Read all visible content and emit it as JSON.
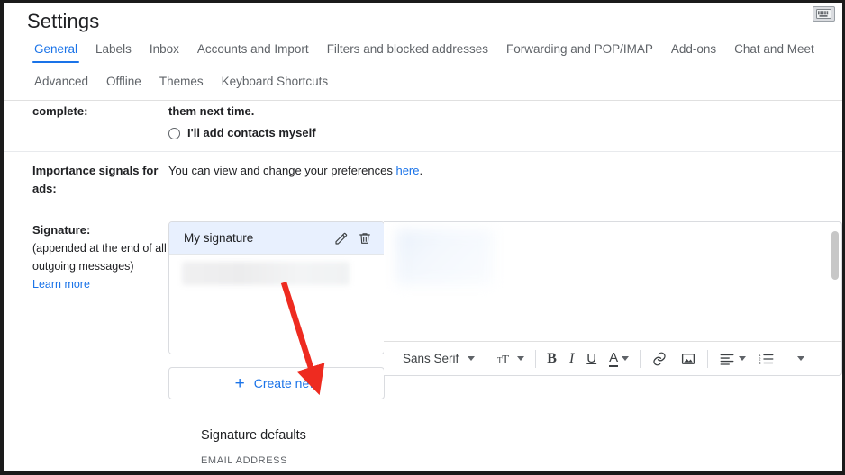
{
  "window": {
    "title": "Settings",
    "keyboard_icon": "keyboard-icon"
  },
  "tabs": {
    "row1": [
      {
        "label": "General",
        "active": true
      },
      {
        "label": "Labels",
        "active": false
      },
      {
        "label": "Inbox",
        "active": false
      },
      {
        "label": "Accounts and Import",
        "active": false
      },
      {
        "label": "Filters and blocked addresses",
        "active": false
      },
      {
        "label": "Forwarding and POP/IMAP",
        "active": false
      },
      {
        "label": "Add-ons",
        "active": false
      },
      {
        "label": "Chat and Meet",
        "active": false
      }
    ],
    "row2": [
      {
        "label": "Advanced",
        "active": false
      },
      {
        "label": "Offline",
        "active": false
      },
      {
        "label": "Themes",
        "active": false
      },
      {
        "label": "Keyboard Shortcuts",
        "active": false
      }
    ]
  },
  "rows": {
    "autocomplete": {
      "label": "complete:",
      "text_line1": "them next time.",
      "radio_label": "I'll add contacts myself"
    },
    "importance": {
      "label_line1": "Importance signals for",
      "label_line2": "ads:",
      "text_before": "You can view and change your preferences ",
      "link": "here",
      "text_after": "."
    },
    "signature": {
      "label": "Signature:",
      "sub_line1": "(appended at the end of all",
      "sub_line2": "outgoing messages)",
      "learn_more": "Learn more",
      "list": [
        {
          "name": "My signature",
          "selected": true,
          "edit_icon": "pencil-icon",
          "delete_icon": "trash-icon"
        }
      ],
      "create_button": {
        "plus": "+",
        "label": "Create new"
      },
      "editor": {
        "toolbar": {
          "font_family": "Sans Serif",
          "font_size_icon": "text-size-icon",
          "bold": "B",
          "italic": "I",
          "underline": "U",
          "text_color": "A",
          "link_icon": "link-icon",
          "image_icon": "image-icon",
          "align_icon": "align-left-icon",
          "numbered_list_icon": "numbered-list-icon",
          "more_icon": "more-options-icon"
        }
      }
    }
  },
  "defaults_section": {
    "heading": "Signature defaults",
    "column_header": "EMAIL ADDRESS"
  },
  "annotation": {
    "arrow_color": "#ee2b20",
    "points_to": "Create new"
  },
  "colors": {
    "accent_blue": "#1a73e8",
    "selected_row_bg": "#e8f0fe",
    "text_primary": "#202124",
    "text_secondary": "#5f6368",
    "border": "#dadce0"
  }
}
